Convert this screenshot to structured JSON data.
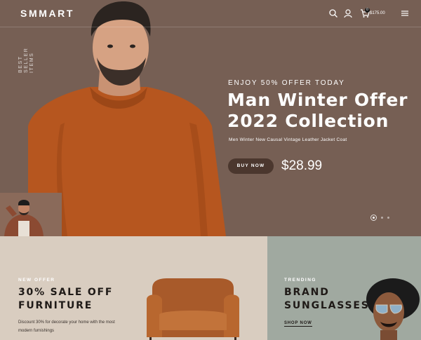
{
  "header": {
    "logo": "SMMART",
    "cart_count": "0",
    "cart_total": "$175.00",
    "icons": [
      "search-icon",
      "user-icon",
      "cart-icon",
      "menu-icon"
    ]
  },
  "hero": {
    "vertical_label_line1": "BEST SELLER",
    "vertical_label_line2": "ITEMS",
    "subtitle": "ENJOY 50% OFFER TODAY",
    "title_line1": "Man Winter Offer",
    "title_line2": "2022 Collection",
    "description": "Men Winter New Causal Vintage Leather Jacket Coat",
    "button_label": "BUY NOW",
    "price": "$28.99",
    "slides": 3,
    "active_slide": 1
  },
  "promos": [
    {
      "tag": "NEW OFFER",
      "title_line1": "30% SALE OFF",
      "title_line2": "FURNITURE",
      "description": "Discount 30% for decorate your home with the most modern furnishings"
    },
    {
      "tag": "TRENDING",
      "title_line1": "BRAND",
      "title_line2": "SUNGLASSES",
      "link_label": "SHOP NOW"
    }
  ],
  "colors": {
    "hero_bg": "#765f54",
    "sweater": "#b6561f",
    "button_bg": "#4b372e",
    "promo_left_bg": "#d9cdc0",
    "promo_right_bg": "#a0a9a0"
  }
}
